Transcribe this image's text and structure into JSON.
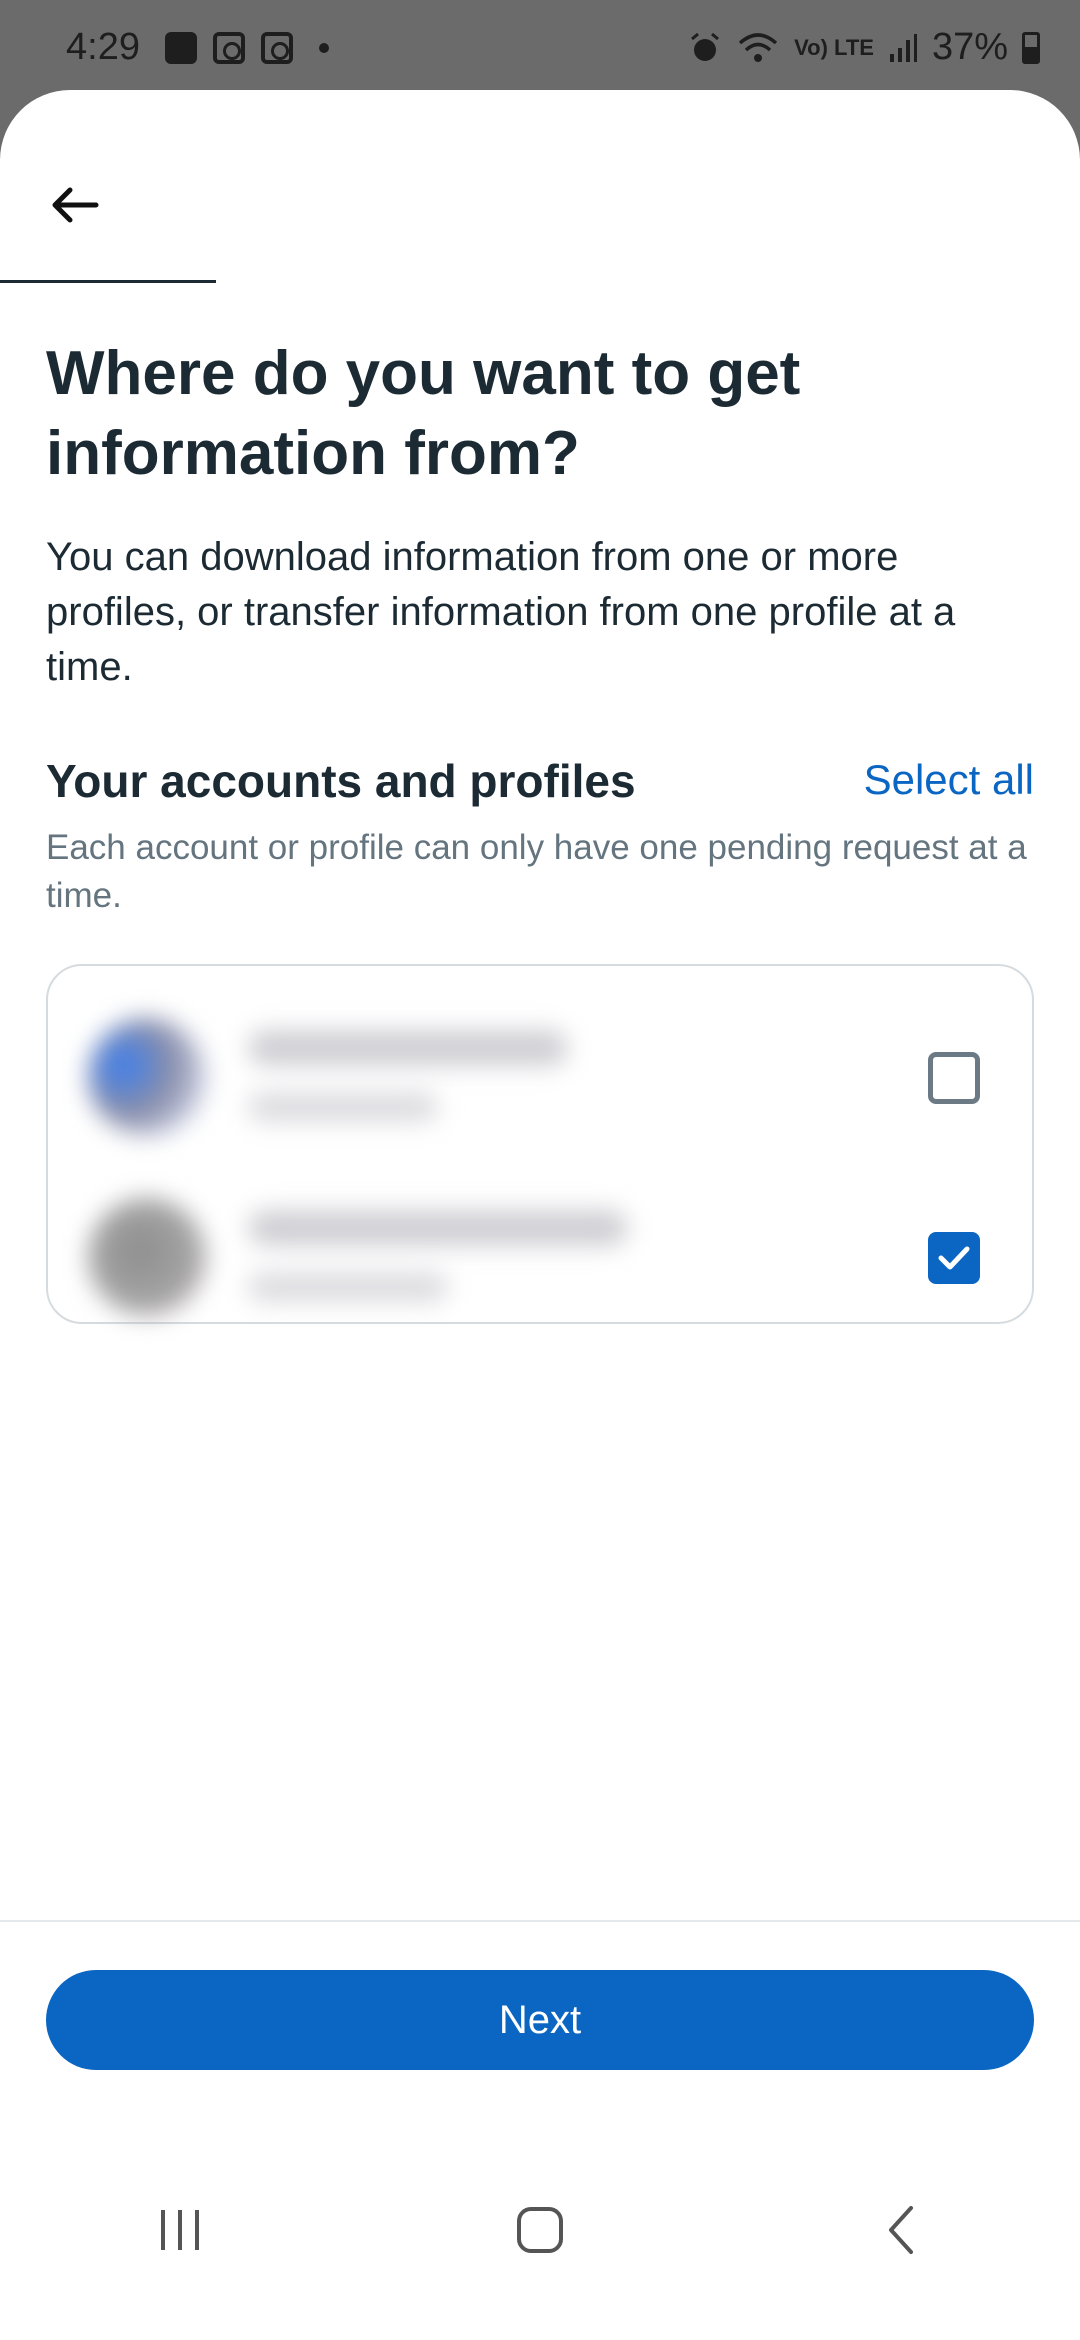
{
  "status_bar": {
    "time": "4:29",
    "network_label": "Vo) LTE",
    "battery": "37%"
  },
  "header": {
    "back_icon": "arrow-left-icon"
  },
  "main": {
    "title": "Where do you want to get information from?",
    "description": "You can download information from one or more profiles, or transfer information from one profile at a time.",
    "section_title": "Your accounts and profiles",
    "select_all_label": "Select all",
    "section_subtitle": "Each account or profile can only have one pending request at a time.",
    "accounts": [
      {
        "checked": false
      },
      {
        "checked": true
      }
    ]
  },
  "footer": {
    "next_label": "Next"
  },
  "nav": {
    "recents_icon": "recents-icon",
    "home_icon": "home-icon",
    "back_icon": "back-icon"
  },
  "colors": {
    "accent": "#0a66c2",
    "text": "#1c2b33",
    "subtext": "#65757f"
  }
}
